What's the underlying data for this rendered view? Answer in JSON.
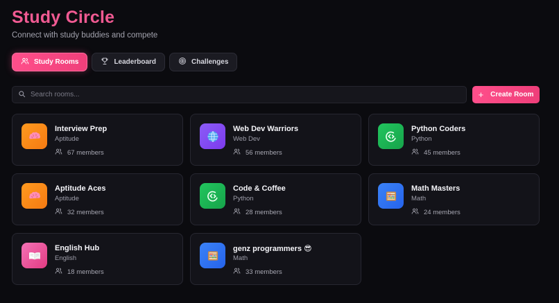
{
  "header": {
    "title": "Study Circle",
    "subtitle": "Connect with study buddies and compete"
  },
  "tabs": [
    {
      "label": "Study Rooms",
      "icon": "users-icon",
      "active": true
    },
    {
      "label": "Leaderboard",
      "icon": "trophy-icon",
      "active": false
    },
    {
      "label": "Challenges",
      "icon": "target-icon",
      "active": false
    }
  ],
  "search": {
    "placeholder": "Search rooms...",
    "value": ""
  },
  "create_button": {
    "label": "Create Room"
  },
  "colors": {
    "accent": "#f05a92",
    "brain": "#f7931e",
    "globe": "#8b5cf6",
    "code": "#22c55e",
    "abacus": "#3b82f6",
    "book": "#ec4899"
  },
  "rooms": [
    {
      "name": "Interview Prep",
      "category": "Aptitude",
      "members": "67 members",
      "icon": "brain-icon"
    },
    {
      "name": "Web Dev Warriors",
      "category": "Web Dev",
      "members": "56 members",
      "icon": "globe-icon"
    },
    {
      "name": "Python Coders",
      "category": "Python",
      "members": "45 members",
      "icon": "code-icon"
    },
    {
      "name": "Aptitude Aces",
      "category": "Aptitude",
      "members": "32 members",
      "icon": "brain-icon"
    },
    {
      "name": "Code & Coffee",
      "category": "Python",
      "members": "28 members",
      "icon": "code-icon"
    },
    {
      "name": "Math Masters",
      "category": "Math",
      "members": "24 members",
      "icon": "abacus-icon"
    },
    {
      "name": "English Hub",
      "category": "English",
      "members": "18 members",
      "icon": "book-icon"
    },
    {
      "name": "genz programmers 😎",
      "category": "Math",
      "members": "33 members",
      "icon": "abacus-icon"
    }
  ]
}
